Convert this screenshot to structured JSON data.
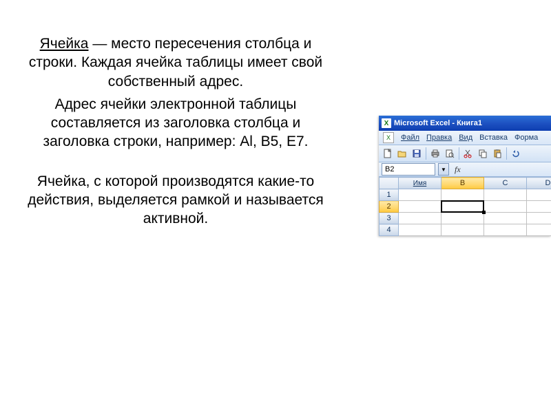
{
  "text": {
    "term": "Ячейка",
    "p1_rest": " — место пересечения столбца и строки. Каждая ячейка таблицы имеет свой собственный адрес.",
    "p2": "Адрес ячейки электронной таблицы составляется из заголовка столбца и заголовка строки, например: Al, B5, E7.",
    "p3": "Ячейка, с которой производятся какие-то действия, выделяется рамкой и называется активной."
  },
  "excel": {
    "title": "Microsoft Excel - Книга1",
    "app_icon_label": "X",
    "menu": {
      "file": "Файл",
      "edit": "Правка",
      "view": "Вид",
      "insert": "Вставка",
      "format": "Форма"
    },
    "namebox_value": "B2",
    "fx_label": "fx",
    "columns": {
      "a_label": "Имя",
      "b": "B",
      "c": "C",
      "d": "D"
    },
    "rows": [
      "1",
      "2",
      "3",
      "4"
    ]
  }
}
